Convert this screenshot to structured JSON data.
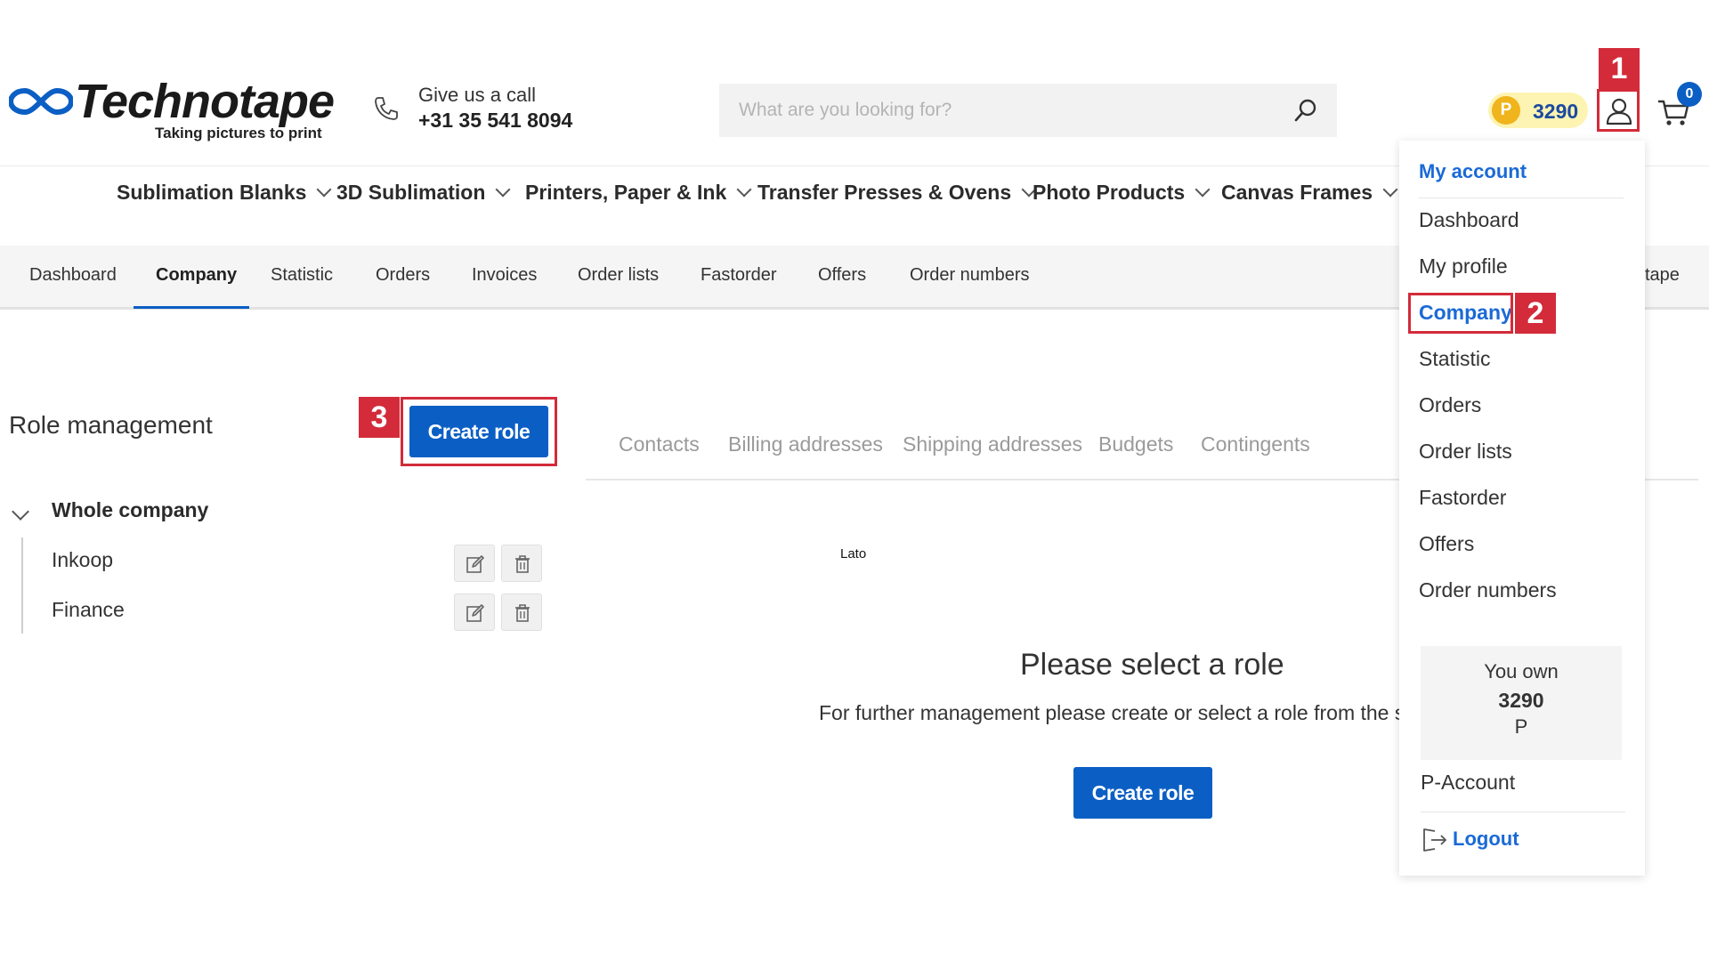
{
  "header": {
    "logo_text": "Technotape",
    "logo_tagline": "Taking pictures to print",
    "phone_label": "Give us a call",
    "phone_number": "+31 35 541 8094",
    "search_placeholder": "What are you looking for?",
    "points_coin": "P",
    "points_value": "3290",
    "cart_count": "0",
    "icons": [
      "phone-icon",
      "search-icon",
      "user-icon",
      "cart-icon"
    ]
  },
  "category_nav": [
    {
      "label": "Sublimation Blanks"
    },
    {
      "label": "3D Sublimation"
    },
    {
      "label": "Printers, Paper & Ink"
    },
    {
      "label": "Transfer Presses & Ovens"
    },
    {
      "label": "Photo Products"
    },
    {
      "label": "Canvas Frames"
    }
  ],
  "account_nav": {
    "items": [
      "Dashboard",
      "Company",
      "Statistic",
      "Orders",
      "Invoices",
      "Order lists",
      "Fastorder",
      "Offers",
      "Order numbers"
    ],
    "active": "Company",
    "right_partial": "tape"
  },
  "role_panel": {
    "title": "Role management",
    "create_button": "Create role",
    "tree": {
      "root": "Whole company",
      "children": [
        "Inkoop",
        "Finance"
      ]
    }
  },
  "company_tabs": [
    "Contacts",
    "Billing addresses",
    "Shipping addresses",
    "Budgets",
    "Contingents"
  ],
  "font_note": "Lato",
  "empty_state": {
    "title": "Please select a role",
    "text": "For further management please create or select a role from the sidel",
    "button": "Create role"
  },
  "dropdown": {
    "header": "My account",
    "items": [
      "Dashboard",
      "My profile",
      "Company",
      "Statistic",
      "Orders",
      "Order lists",
      "Fastorder",
      "Offers",
      "Order numbers"
    ],
    "active": "Company",
    "points_line1": "You own",
    "points_line2": "3290",
    "points_line3": "P",
    "p_account": "P-Account",
    "logout": "Logout"
  },
  "annotations": [
    "1",
    "2",
    "3"
  ],
  "colors": {
    "brand_blue": "#0b5fc4",
    "link_blue": "#1a6ad6",
    "annotation_red": "#d32b3a",
    "coin_yellow": "#f0b41c",
    "badge_bg": "#fdf3b2"
  }
}
